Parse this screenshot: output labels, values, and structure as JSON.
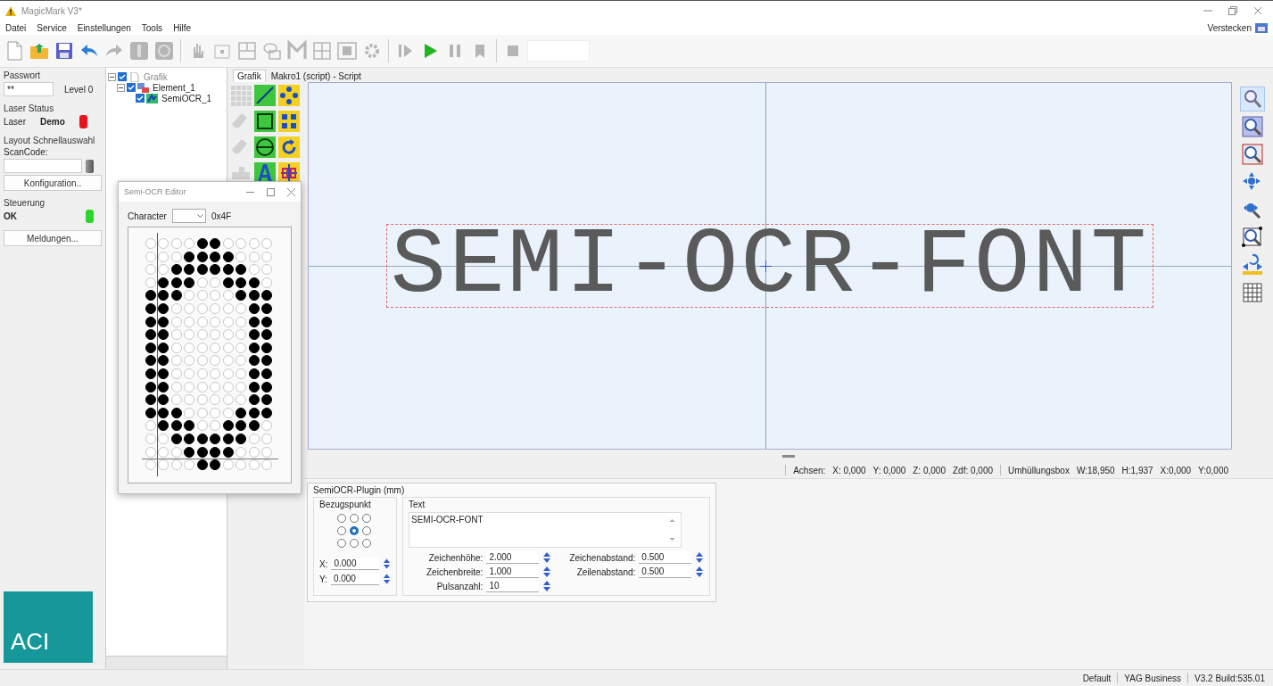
{
  "window": {
    "title": "MagicMark V3*"
  },
  "menu": [
    "Datei",
    "Service",
    "Einstellungen",
    "Tools",
    "Hilfe"
  ],
  "hide_button": {
    "label": "Verstecken"
  },
  "toolbar": [
    {
      "kind": "new",
      "disabled": false
    },
    {
      "kind": "open",
      "disabled": false
    },
    {
      "kind": "save",
      "disabled": false
    },
    {
      "kind": "undo",
      "disabled": false
    },
    {
      "kind": "redo",
      "disabled": true
    },
    {
      "kind": "block",
      "disabled": true
    },
    {
      "kind": "target",
      "disabled": true
    },
    {
      "kind": "separator"
    },
    {
      "kind": "hand",
      "disabled": true
    },
    {
      "kind": "rectdot",
      "disabled": true
    },
    {
      "kind": "layout",
      "disabled": true
    },
    {
      "kind": "shapes",
      "disabled": true
    },
    {
      "kind": "letter",
      "disabled": true
    },
    {
      "kind": "grid",
      "disabled": true
    },
    {
      "kind": "image",
      "disabled": true
    },
    {
      "kind": "gear",
      "disabled": true
    },
    {
      "kind": "separator"
    },
    {
      "kind": "step",
      "disabled": true
    },
    {
      "kind": "play",
      "disabled": false
    },
    {
      "kind": "pause",
      "disabled": true
    },
    {
      "kind": "bin",
      "disabled": true
    },
    {
      "kind": "separator"
    },
    {
      "kind": "stop",
      "disabled": true
    },
    {
      "kind": "field"
    }
  ],
  "left_panel": {
    "password": {
      "label": "Passwort",
      "value": "**",
      "user_level": "Level 0"
    },
    "laser_status": {
      "heading": "Laser Status",
      "label": "Laser",
      "value": "Demo",
      "color": "#e8141c"
    },
    "layout": {
      "heading": "Layout Schnellauswahl",
      "label": "ScanCode:",
      "config_button": "Konfiguration.."
    },
    "control": {
      "heading": "Steuerung",
      "value": "OK",
      "color": "#2bd62b"
    },
    "messages_button": "Meldungen...",
    "logo": "ACI"
  },
  "tree": [
    {
      "label": "Grafik",
      "checked": true,
      "expanded": true,
      "children": [
        {
          "label": "Element_1",
          "checked": true,
          "expanded": true,
          "children": [
            {
              "label": "SemiOCR_1",
              "checked": true
            }
          ]
        }
      ]
    }
  ],
  "tabs": [
    {
      "label": "Grafik",
      "selected": true
    },
    {
      "label": "Makro1 (script) - Script",
      "selected": false
    }
  ],
  "palette": [
    {
      "kind": "grid",
      "disabled": true
    },
    {
      "kind": "line",
      "disabled": false
    },
    {
      "kind": "dots",
      "disabled": false
    },
    {
      "kind": "eraser",
      "disabled": true
    },
    {
      "kind": "rect",
      "disabled": false
    },
    {
      "kind": "dots4",
      "disabled": false
    },
    {
      "kind": "eraser",
      "disabled": true
    },
    {
      "kind": "ellipse",
      "disabled": false
    },
    {
      "kind": "rotate",
      "disabled": false
    },
    {
      "kind": "stamp",
      "disabled": true
    },
    {
      "kind": "text",
      "disabled": false
    },
    {
      "kind": "ocr",
      "disabled": false
    }
  ],
  "canvas": {
    "text": "SEMI-OCR-FONT"
  },
  "zoom_tools": [
    {
      "kind": "zoom",
      "selected": true
    },
    {
      "kind": "zoom-fit",
      "selected": false
    },
    {
      "kind": "zoom-all",
      "selected": false
    },
    {
      "kind": "pan",
      "selected": false
    },
    {
      "kind": "zoom-pan",
      "selected": false
    },
    {
      "kind": "zoom-select",
      "selected": false
    },
    {
      "kind": "mirror",
      "selected": false
    },
    {
      "kind": "grid",
      "selected": false
    }
  ],
  "status_strip": {
    "axes_label": "Achsen:",
    "axes": [
      "X: 0,000",
      "Y: 0,000",
      "Z: 0,000",
      "Zdf: 0,000"
    ],
    "box_label": "Umhüllungsbox",
    "box": [
      "W:18,950",
      "H:1,937",
      "X:0,000",
      "Y:0,000"
    ]
  },
  "properties": {
    "title": "SemiOCR-Plugin (mm)",
    "reference": {
      "title": "Bezugspunkt",
      "points": [
        {
          "selected": false
        },
        {
          "selected": false
        },
        {
          "selected": false
        },
        {
          "selected": false
        },
        {
          "selected": true
        },
        {
          "selected": false
        },
        {
          "selected": false
        },
        {
          "selected": false
        },
        {
          "selected": false
        }
      ]
    },
    "x": {
      "label": "X:",
      "value": "0.000"
    },
    "y": {
      "label": "Y:",
      "value": "0.000"
    },
    "text": {
      "label": "Text",
      "value": "SEMI-OCR-FONT"
    },
    "fields": [
      {
        "label": "Zeichenhöhe:",
        "value": "2.000"
      },
      {
        "label": "Zeichenbreite:",
        "value": "1.000"
      },
      {
        "label": "Pulsanzahl:",
        "value": "10"
      },
      {
        "label": "Zeichenabstand:",
        "value": "0.500"
      },
      {
        "label": "Zeilenabstand:",
        "value": "0.500"
      }
    ]
  },
  "status_bar": [
    "Default",
    "YAG Business",
    "V3.2 Build:535.01"
  ],
  "editor": {
    "title": "Semi-OCR Editor",
    "character_label": "Character",
    "code": "0x4F",
    "rows": [
      [
        false,
        false,
        false,
        false,
        true,
        true,
        false,
        false,
        false,
        false
      ],
      [
        false,
        false,
        false,
        true,
        true,
        true,
        true,
        false,
        false,
        false
      ],
      [
        false,
        false,
        true,
        true,
        true,
        true,
        true,
        true,
        false,
        false
      ],
      [
        false,
        true,
        true,
        true,
        false,
        false,
        true,
        true,
        true,
        false
      ],
      [
        true,
        true,
        true,
        false,
        false,
        false,
        false,
        true,
        true,
        true
      ],
      [
        true,
        true,
        false,
        false,
        false,
        false,
        false,
        false,
        true,
        true
      ],
      [
        true,
        true,
        false,
        false,
        false,
        false,
        false,
        false,
        true,
        true
      ],
      [
        true,
        true,
        false,
        false,
        false,
        false,
        false,
        false,
        true,
        true
      ],
      [
        true,
        true,
        false,
        false,
        false,
        false,
        false,
        false,
        true,
        true
      ],
      [
        true,
        true,
        false,
        false,
        false,
        false,
        false,
        false,
        true,
        true
      ],
      [
        true,
        true,
        false,
        false,
        false,
        false,
        false,
        false,
        true,
        true
      ],
      [
        true,
        true,
        false,
        false,
        false,
        false,
        false,
        false,
        true,
        true
      ],
      [
        true,
        true,
        false,
        false,
        false,
        false,
        false,
        false,
        true,
        true
      ],
      [
        true,
        true,
        true,
        false,
        false,
        false,
        false,
        true,
        true,
        true
      ],
      [
        false,
        true,
        true,
        true,
        false,
        false,
        true,
        true,
        true,
        false
      ],
      [
        false,
        false,
        true,
        true,
        true,
        true,
        true,
        true,
        false,
        false
      ],
      [
        false,
        false,
        false,
        true,
        true,
        true,
        true,
        false,
        false,
        false
      ],
      [
        false,
        false,
        false,
        false,
        true,
        true,
        false,
        false,
        false,
        false
      ]
    ]
  }
}
